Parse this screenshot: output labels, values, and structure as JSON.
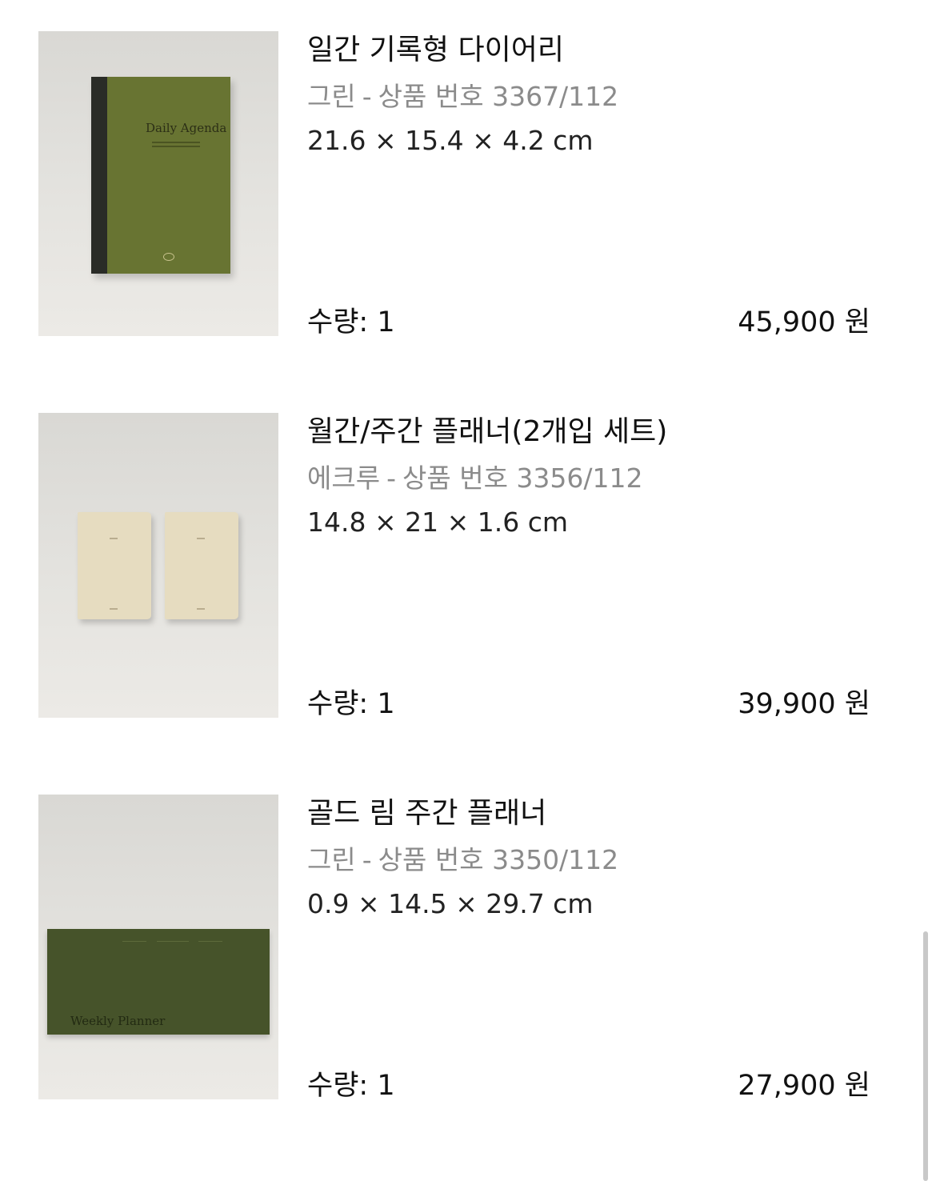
{
  "items": [
    {
      "name": "일간 기록형 다이어리",
      "color": "그린",
      "product_code": "상품 번호 3367/112",
      "dimensions": "21.6 × 15.4 × 4.2 cm",
      "quantity": "수량: 1",
      "price": "45,900 원",
      "image_text": "Daily Agenda"
    },
    {
      "name": "월간/주간 플래너(2개입 세트)",
      "color": "에크루",
      "product_code": "상품 번호 3356/112",
      "dimensions": "14.8 × 21 × 1.6 cm",
      "quantity": "수량: 1",
      "price": "39,900 원"
    },
    {
      "name": "골드 림 주간 플래너",
      "color": "그린",
      "product_code": "상품 번호 3350/112",
      "dimensions": "0.9 × 14.5 × 29.7 cm",
      "quantity": "수량: 1",
      "price": "27,900 원",
      "image_text": "Weekly Planner"
    }
  ],
  "separator": "-"
}
